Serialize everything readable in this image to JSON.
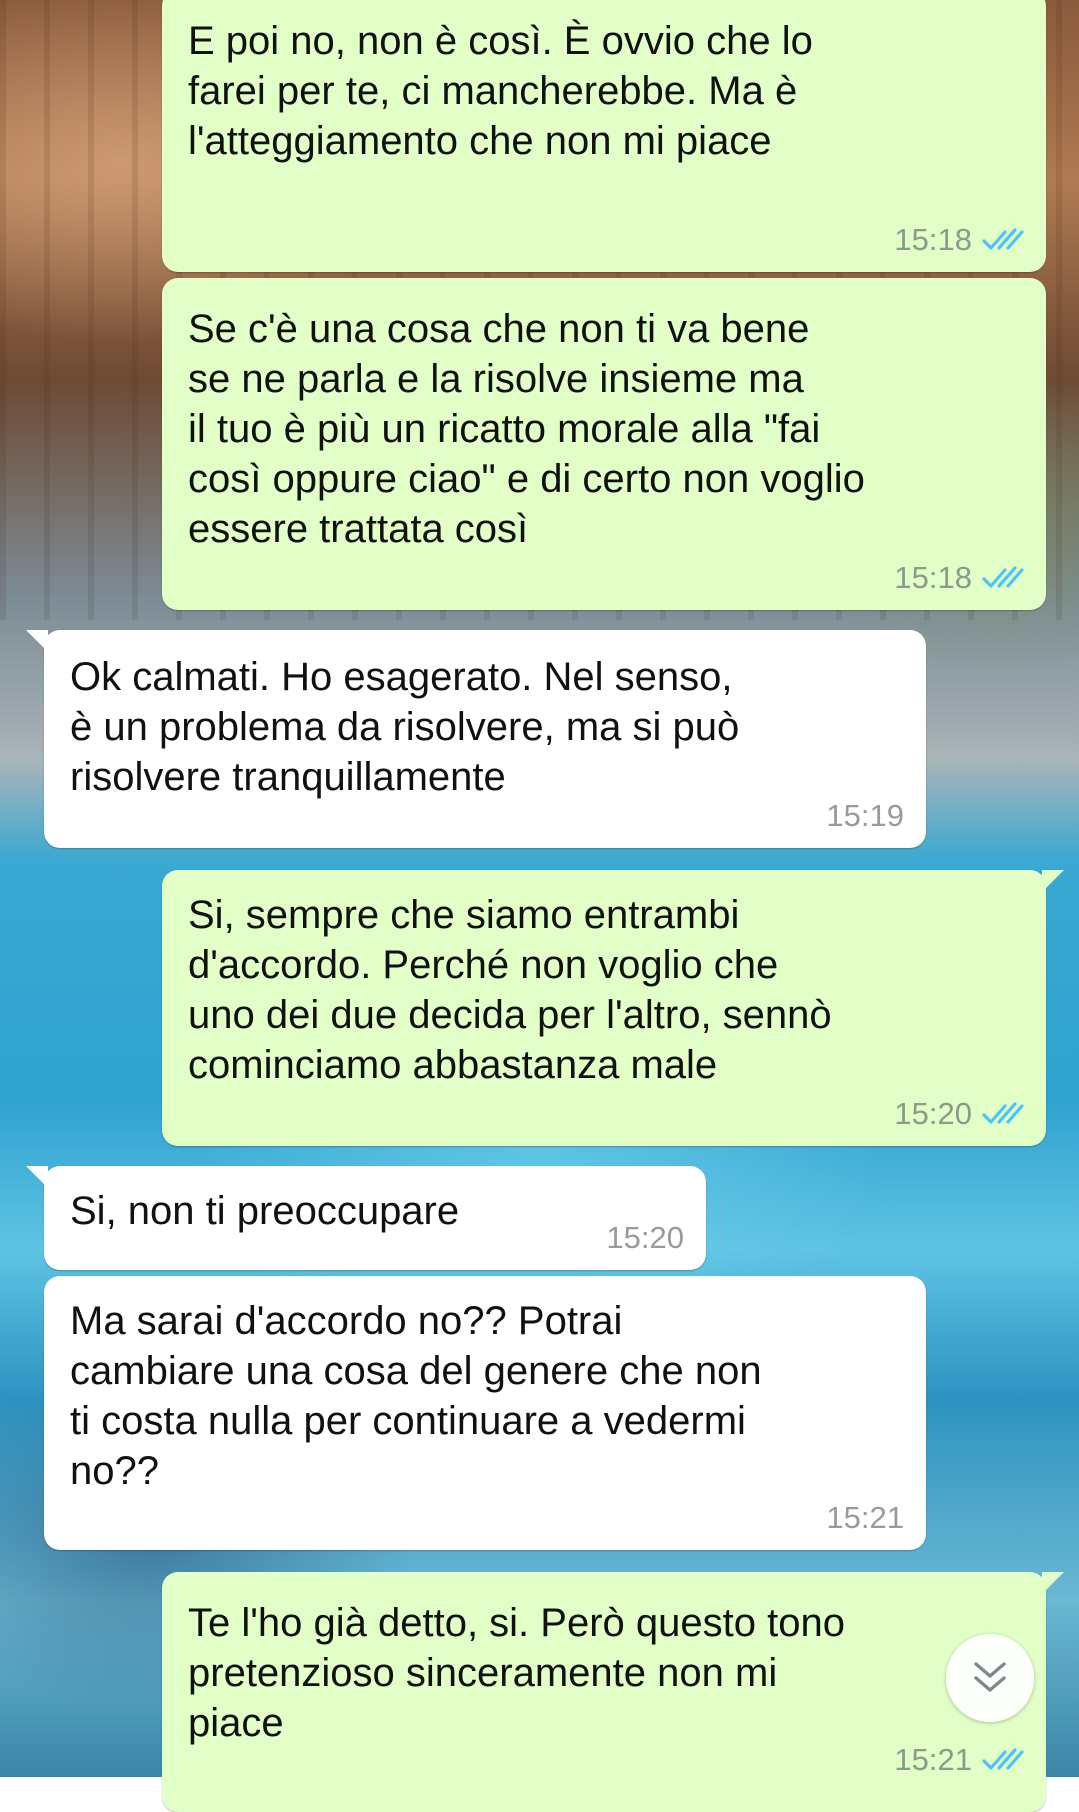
{
  "chat": {
    "messages": [
      {
        "direction": "outgoing",
        "text": "E poi no, non è così. È ovvio che lo\nfarei per te, ci mancherebbe. Ma è\nl'atteggiamento che non mi piace",
        "time": "15:18",
        "status": "read"
      },
      {
        "direction": "outgoing",
        "text": "Se c'è una cosa che non ti va bene\nse ne parla e la risolve insieme ma\nil tuo è più un ricatto morale alla \"fai\ncosì oppure ciao\" e di certo non voglio\nessere trattata così",
        "time": "15:18",
        "status": "read"
      },
      {
        "direction": "incoming",
        "text": "Ok calmati. Ho esagerato. Nel senso,\nè un problema da risolvere, ma si può\nrisolvere tranquillamente",
        "time": "15:19"
      },
      {
        "direction": "outgoing",
        "text": "Si, sempre che siamo entrambi\nd'accordo. Perché non voglio che\nuno dei due decida per l'altro, sennò\ncominciamo abbastanza male",
        "time": "15:20",
        "status": "read"
      },
      {
        "direction": "incoming",
        "text": "Si, non ti preoccupare",
        "time": "15:20"
      },
      {
        "direction": "incoming",
        "text": "Ma sarai d'accordo no?? Potrai\ncambiare una cosa del genere che non\nti costa nulla per continuare a vedermi\nno??",
        "time": "15:21"
      },
      {
        "direction": "outgoing",
        "text": "Te l'ho già detto, si. Però questo tono\npretenzioso sinceramente non mi\npiace",
        "time": "15:21",
        "status": "read"
      }
    ]
  },
  "colors": {
    "outgoing_bubble": "#e1ffc7",
    "incoming_bubble": "#ffffff",
    "read_ticks": "#4fc3f7"
  },
  "icons": {
    "read_receipt": "double-check-icon",
    "scroll_down": "double-chevron-down-icon"
  }
}
